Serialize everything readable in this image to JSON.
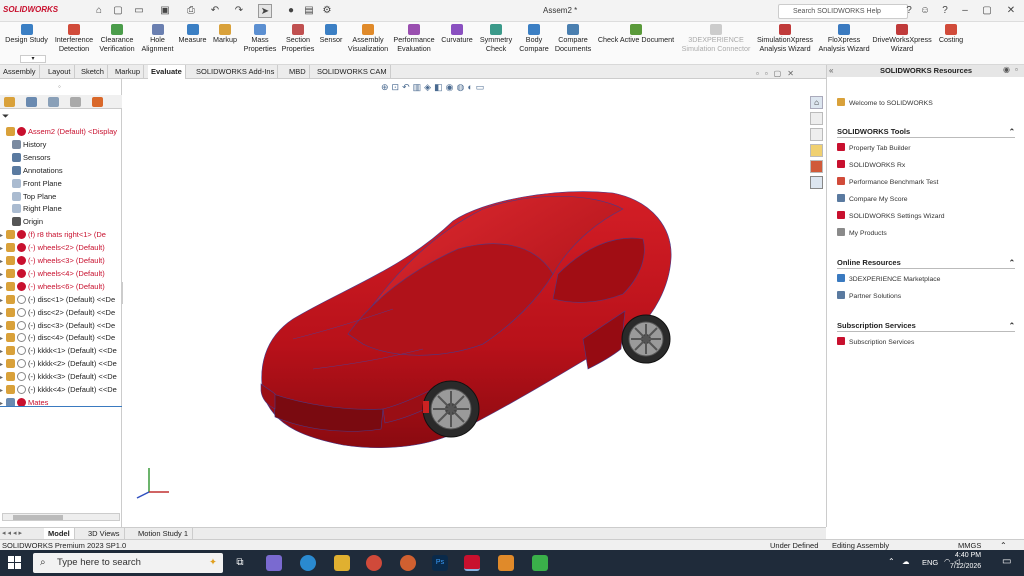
{
  "titlebar": {
    "logo": "SOLIDWORKS",
    "document_title": "Assem2 *",
    "help_search_placeholder": "Search SOLIDWORKS Help"
  },
  "ribbon": {
    "buttons": [
      {
        "l1": "Design Study",
        "l2": "",
        "color": "#3b7fc4"
      },
      {
        "l1": "Interference",
        "l2": "Detection",
        "color": "#d14b3a"
      },
      {
        "l1": "Clearance",
        "l2": "Verification",
        "color": "#4a9c4a"
      },
      {
        "l1": "Hole",
        "l2": "Alignment",
        "color": "#6a7fb0"
      },
      {
        "l1": "Measure",
        "l2": "",
        "color": "#3b7fc4"
      },
      {
        "l1": "Markup",
        "l2": "",
        "color": "#d9a13a"
      },
      {
        "l1": "Mass",
        "l2": "Properties",
        "color": "#5b8fd1"
      },
      {
        "l1": "Section",
        "l2": "Properties",
        "color": "#c05050"
      },
      {
        "l1": "Sensor",
        "l2": "",
        "color": "#3b7fc4"
      },
      {
        "l1": "Assembly",
        "l2": "Visualization",
        "color": "#e08a2a"
      },
      {
        "l1": "Performance",
        "l2": "Evaluation",
        "color": "#9a4fb0"
      },
      {
        "l1": "Curvature",
        "l2": "",
        "color": "#8a50c0"
      },
      {
        "l1": "Symmetry",
        "l2": "Check",
        "color": "#3b9a8a"
      },
      {
        "l1": "Body",
        "l2": "Compare",
        "color": "#3b7fc4"
      },
      {
        "l1": "Compare",
        "l2": "Documents",
        "color": "#4a7fb0"
      },
      {
        "l1": "Check Active Document",
        "l2": "",
        "color": "#5a9a3a"
      },
      {
        "l1": "3DEXPERIENCE",
        "l2": "Simulation Connector",
        "color": "#cccccc"
      },
      {
        "l1": "SimulationXpress",
        "l2": "Analysis Wizard",
        "color": "#c03a3a"
      },
      {
        "l1": "FloXpress",
        "l2": "Analysis Wizard",
        "color": "#3a7ac0"
      },
      {
        "l1": "DriveWorksXpress",
        "l2": "Wizard",
        "color": "#c03a3a"
      },
      {
        "l1": "Costing",
        "l2": "",
        "color": "#d14b3a"
      }
    ]
  },
  "tabs": [
    "Assembly",
    "Layout",
    "Sketch",
    "Markup",
    "Evaluate",
    "SOLIDWORKS Add-Ins",
    "MBD",
    "SOLIDWORKS CAM"
  ],
  "active_tab": "Evaluate",
  "tree": [
    {
      "label": "Assem2 (Default) <Display",
      "red": true,
      "color": "#d9a13a"
    },
    {
      "label": "History",
      "red": false,
      "color": "#7a8aa0"
    },
    {
      "label": "Sensors",
      "red": false,
      "color": "#5a7aa0"
    },
    {
      "label": "Annotations",
      "red": false,
      "color": "#5a7aa0"
    },
    {
      "label": "Front Plane",
      "red": false,
      "color": "#aabbd0"
    },
    {
      "label": "Top Plane",
      "red": false,
      "color": "#aabbd0"
    },
    {
      "label": "Right Plane",
      "red": false,
      "color": "#aabbd0"
    },
    {
      "label": "Origin",
      "red": false,
      "color": "#555555"
    },
    {
      "label": "(f) r8 thats right<1> (De",
      "red": true,
      "color": "#d9a13a"
    },
    {
      "label": "(-) wheels<2> (Default)",
      "red": true,
      "color": "#d9a13a"
    },
    {
      "label": "(-) wheels<3> (Default)",
      "red": true,
      "color": "#d9a13a"
    },
    {
      "label": "(-) wheels<4> (Default)",
      "red": true,
      "color": "#d9a13a"
    },
    {
      "label": "(-) wheels<6> (Default)",
      "red": true,
      "color": "#d9a13a"
    },
    {
      "label": "(-) disc<1> (Default) <<De",
      "red": false,
      "color": "#d9a13a"
    },
    {
      "label": "(-) disc<2> (Default) <<De",
      "red": false,
      "color": "#d9a13a"
    },
    {
      "label": "(-) disc<3> (Default) <<De",
      "red": false,
      "color": "#d9a13a"
    },
    {
      "label": "(-) disc<4> (Default) <<De",
      "red": false,
      "color": "#d9a13a"
    },
    {
      "label": "(-) kkkk<1> (Default) <<De",
      "red": false,
      "color": "#d9a13a"
    },
    {
      "label": "(-) kkkk<2> (Default) <<De",
      "red": false,
      "color": "#d9a13a"
    },
    {
      "label": "(-) kkkk<3> (Default) <<De",
      "red": false,
      "color": "#d9a13a"
    },
    {
      "label": "(-) kkkk<4> (Default) <<De",
      "red": false,
      "color": "#d9a13a"
    },
    {
      "label": "Mates",
      "red": true,
      "color": "#6a8ab0"
    }
  ],
  "resources": {
    "title": "SOLIDWORKS Resources",
    "welcome": "Welcome to SOLIDWORKS",
    "tools_header": "SOLIDWORKS Tools",
    "tools": [
      "Property Tab Builder",
      "SOLIDWORKS Rx",
      "Performance Benchmark Test",
      "Compare My Score",
      "SOLIDWORKS Settings Wizard",
      "My Products"
    ],
    "online_header": "Online Resources",
    "online": [
      "3DEXPERIENCE Marketplace",
      "Partner Solutions"
    ],
    "subscription_header": "Subscription Services",
    "subscription": [
      "Subscription Services"
    ]
  },
  "bottom_tabs": [
    "Model",
    "3D Views",
    "Motion Study 1"
  ],
  "status": {
    "product": "SOLIDWORKS Premium 2023 SP1.0",
    "state": "Under Defined",
    "mode": "Editing Assembly",
    "units": "MMGS"
  },
  "taskbar": {
    "search_placeholder": "Type here to search",
    "language": "ENG",
    "time": "4:40 PM",
    "date": "7/12/2026"
  },
  "colors": {
    "car_body": "#c0141c",
    "brand_red": "#c8102e",
    "taskbar": "#1f2b3a"
  }
}
